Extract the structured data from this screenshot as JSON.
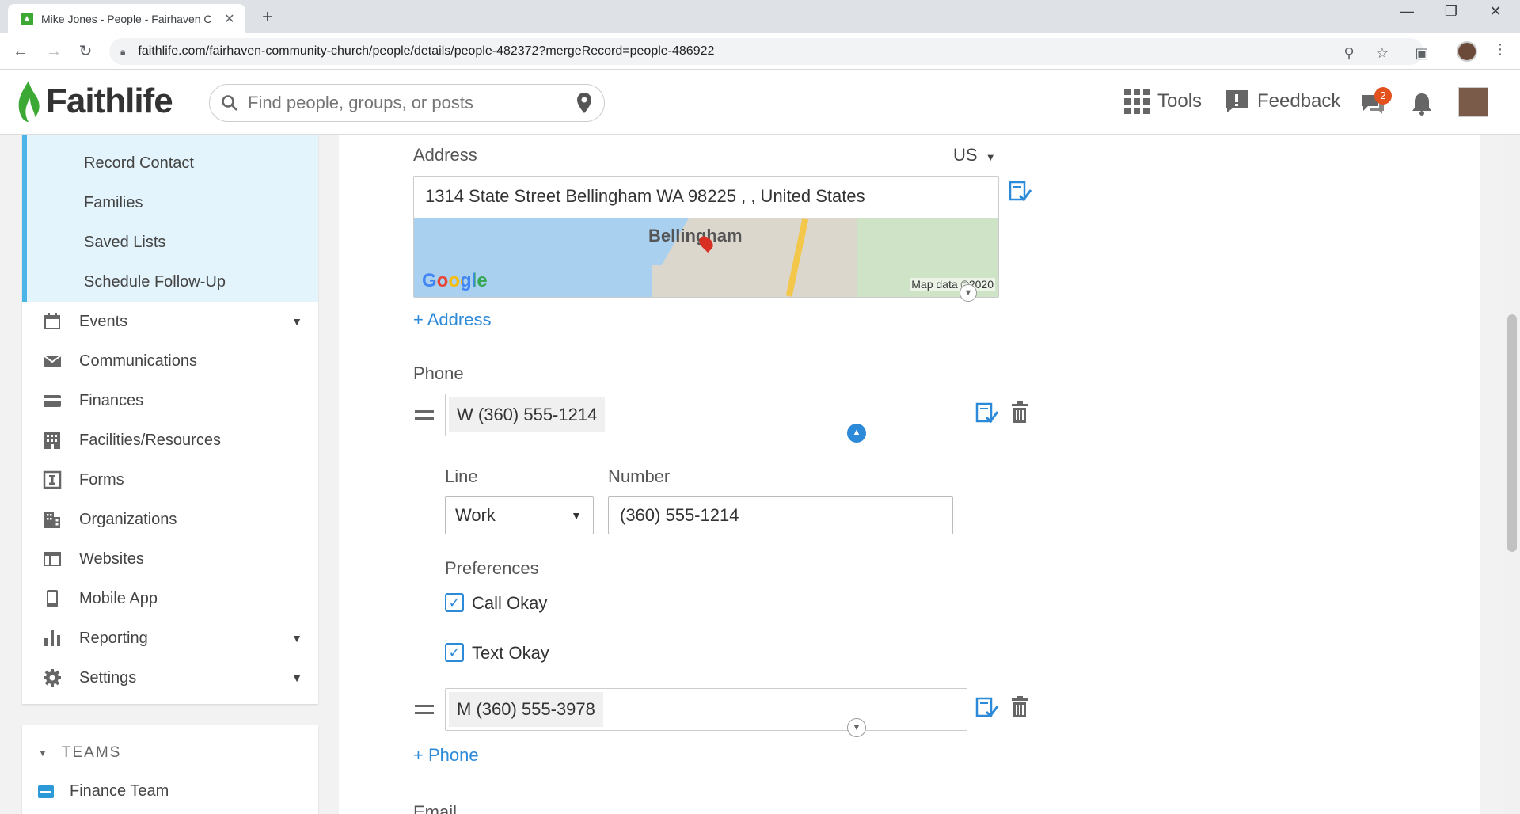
{
  "browser": {
    "tab_title": "Mike Jones - People - Fairhaven C",
    "url": "faithlife.com/fairhaven-community-church/people/details/people-482372?mergeRecord=people-486922"
  },
  "header": {
    "logo_text": "Faithlife",
    "search_placeholder": "Find people, groups, or posts",
    "tools_label": "Tools",
    "feedback_label": "Feedback",
    "notification_count": "2"
  },
  "sidebar": {
    "sub_items": [
      "Record Contact",
      "Families",
      "Saved Lists",
      "Schedule Follow-Up"
    ],
    "nav_items": [
      {
        "label": "Events",
        "icon": "calendar-icon",
        "expandable": true
      },
      {
        "label": "Communications",
        "icon": "envelope-icon",
        "expandable": false
      },
      {
        "label": "Finances",
        "icon": "credit-card-icon",
        "expandable": false
      },
      {
        "label": "Facilities/Resources",
        "icon": "building-icon",
        "expandable": false
      },
      {
        "label": "Forms",
        "icon": "form-icon",
        "expandable": false
      },
      {
        "label": "Organizations",
        "icon": "organization-icon",
        "expandable": false
      },
      {
        "label": "Websites",
        "icon": "website-icon",
        "expandable": false
      },
      {
        "label": "Mobile App",
        "icon": "mobile-icon",
        "expandable": false
      },
      {
        "label": "Reporting",
        "icon": "bar-chart-icon",
        "expandable": true
      },
      {
        "label": "Settings",
        "icon": "gear-icon",
        "expandable": true
      }
    ],
    "teams_heading": "TEAMS",
    "teams": [
      "Finance Team"
    ]
  },
  "address": {
    "label": "Address",
    "country": "US",
    "value": "1314 State Street Bellingham WA 98225 ,   , United States",
    "map_city": "Bellingham",
    "map_logo": "Google",
    "map_data": "Map data ©2020",
    "add_label": "+ Address"
  },
  "phone": {
    "label": "Phone",
    "entries": [
      "W (360) 555-1214",
      "M (360) 555-3978"
    ],
    "line_label": "Line",
    "line_value": "Work",
    "number_label": "Number",
    "number_value": "(360) 555-1214",
    "preferences_label": "Preferences",
    "call_okay": "Call Okay",
    "text_okay": "Text Okay",
    "add_label": "+ Phone"
  },
  "email": {
    "label": "Email"
  },
  "colors": {
    "accent": "#2d8ad8",
    "sidebar_highlight": "#e3f4fc",
    "brand_green": "#3ca935",
    "badge": "#e3521c"
  }
}
